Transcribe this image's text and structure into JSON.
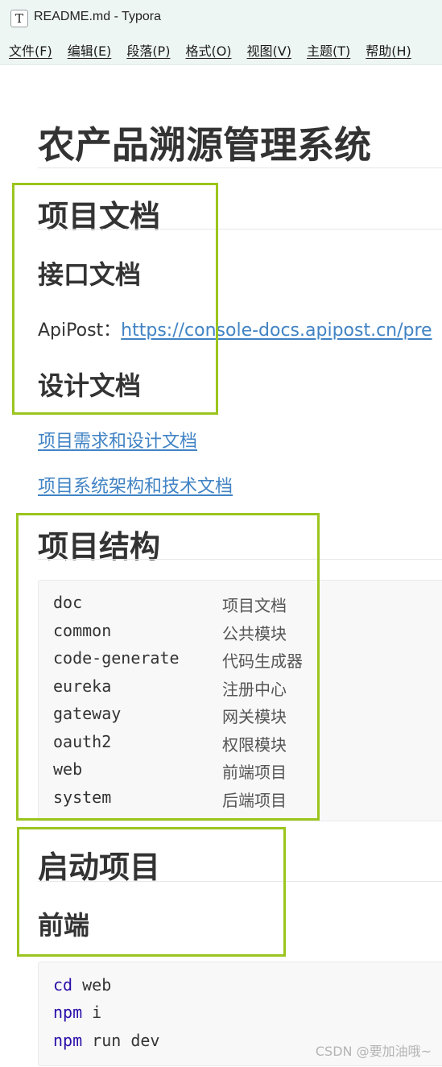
{
  "window": {
    "icon_glyph": "T",
    "title": "README.md - Typora"
  },
  "menu": [
    {
      "label": "文件(F)"
    },
    {
      "label": "编辑(E)"
    },
    {
      "label": "段落(P)"
    },
    {
      "label": "格式(O)"
    },
    {
      "label": "视图(V)"
    },
    {
      "label": "主题(T)"
    },
    {
      "label": "帮助(H)"
    }
  ],
  "document": {
    "title": "农产品溯源管理系统",
    "project_docs": {
      "heading": "项目文档",
      "api_heading": "接口文档",
      "api_label": "ApiPost：",
      "api_link": "https://console-docs.apipost.cn/pre",
      "design_heading": "设计文档",
      "links": [
        "项目需求和设计文档",
        "项目系统架构和技术文档"
      ]
    },
    "structure": {
      "heading": "项目结构",
      "rows": [
        {
          "name": "doc",
          "desc": "项目文档"
        },
        {
          "name": "common",
          "desc": "公共模块"
        },
        {
          "name": "code-generate",
          "desc": "代码生成器"
        },
        {
          "name": "eureka",
          "desc": "注册中心"
        },
        {
          "name": "gateway",
          "desc": "网关模块"
        },
        {
          "name": "oauth2",
          "desc": "权限模块"
        },
        {
          "name": "web",
          "desc": "前端项目"
        },
        {
          "name": "system",
          "desc": "后端项目"
        }
      ]
    },
    "startup": {
      "heading": "启动项目",
      "frontend_heading": "前端",
      "commands": [
        {
          "cmd": "cd",
          "args": " web"
        },
        {
          "cmd": "npm",
          "args": " i"
        },
        {
          "cmd": "npm",
          "args": " run dev"
        }
      ]
    }
  },
  "watermark": "CSDN @要加油哦~",
  "colors": {
    "highlight_box": "#9bc51e",
    "link": "#4183c4",
    "keyword": "#2a0ea8",
    "chrome_bg": "#eef6f3"
  }
}
